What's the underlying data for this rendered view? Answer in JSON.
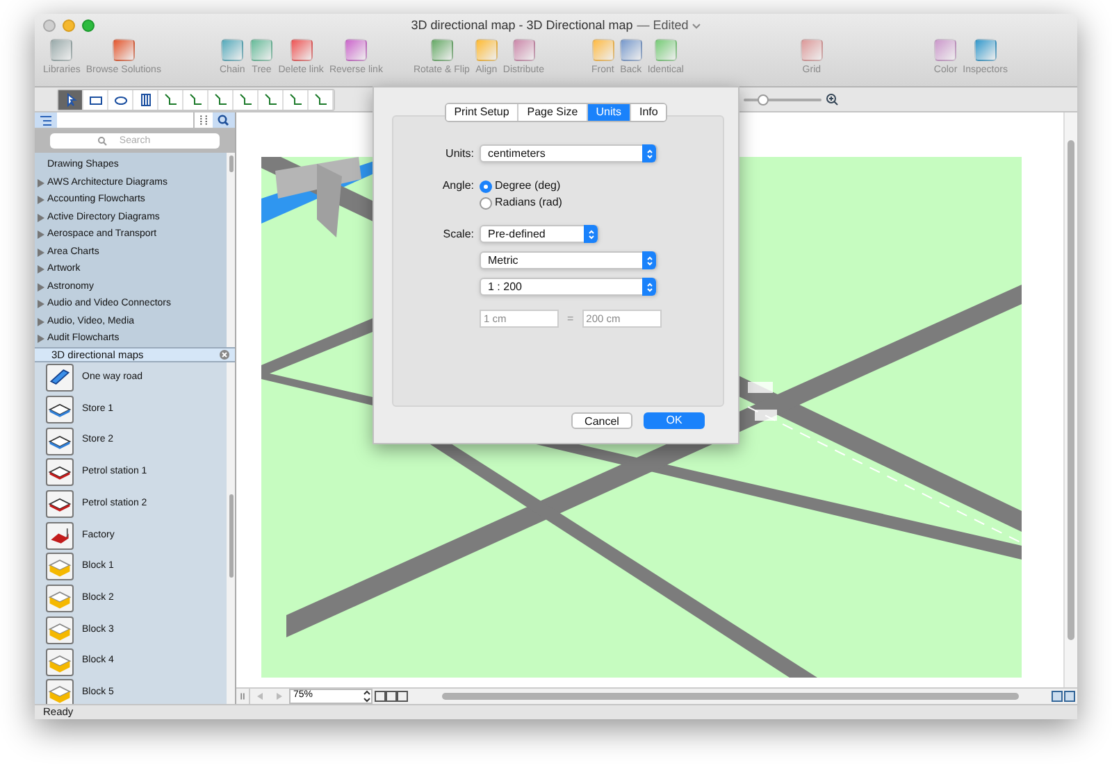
{
  "window": {
    "title": "3D directional map - 3D Directional map",
    "edited": "— Edited"
  },
  "toolbar": {
    "groups": [
      [
        {
          "label": "Libraries"
        },
        {
          "label": "Browse Solutions"
        }
      ],
      [
        {
          "label": "Chain"
        },
        {
          "label": "Tree"
        },
        {
          "label": "Delete link"
        },
        {
          "label": "Reverse link"
        }
      ],
      [
        {
          "label": "Rotate & Flip"
        },
        {
          "label": "Align"
        },
        {
          "label": "Distribute"
        }
      ],
      [
        {
          "label": "Front"
        },
        {
          "label": "Back"
        },
        {
          "label": "Identical"
        }
      ],
      [
        {
          "label": "Grid"
        }
      ],
      [
        {
          "label": "Color"
        },
        {
          "label": "Inspectors"
        }
      ]
    ]
  },
  "zoom_slider": {
    "level": 0.2
  },
  "sidebar": {
    "search": {
      "placeholder": "Search"
    },
    "libraries": [
      {
        "label": "Drawing Shapes",
        "kind": "plain"
      },
      {
        "label": "AWS Architecture Diagrams",
        "kind": "group"
      },
      {
        "label": "Accounting Flowcharts",
        "kind": "group"
      },
      {
        "label": "Active Directory Diagrams",
        "kind": "group"
      },
      {
        "label": "Aerospace and Transport",
        "kind": "group"
      },
      {
        "label": "Area Charts",
        "kind": "group"
      },
      {
        "label": "Artwork",
        "kind": "group"
      },
      {
        "label": "Astronomy",
        "kind": "group"
      },
      {
        "label": "Audio and Video Connectors",
        "kind": "group"
      },
      {
        "label": "Audio, Video, Media",
        "kind": "group"
      },
      {
        "label": "Audit Flowcharts",
        "kind": "group"
      }
    ],
    "open_library": {
      "title": "3D directional maps",
      "shapes": [
        {
          "label": "One way road",
          "kind": "road"
        },
        {
          "label": "Store 1",
          "kind": "store"
        },
        {
          "label": "Store 2",
          "kind": "store"
        },
        {
          "label": "Petrol station 1",
          "kind": "petrol"
        },
        {
          "label": "Petrol station 2",
          "kind": "petrol"
        },
        {
          "label": "Factory",
          "kind": "factory"
        },
        {
          "label": "Block 1",
          "kind": "block"
        },
        {
          "label": "Block 2",
          "kind": "block"
        },
        {
          "label": "Block 3",
          "kind": "block"
        },
        {
          "label": "Block 4",
          "kind": "block"
        },
        {
          "label": "Block 5",
          "kind": "block"
        }
      ]
    }
  },
  "dialog": {
    "tabs": [
      {
        "label": "Print Setup",
        "selected": false
      },
      {
        "label": "Page Size",
        "selected": false
      },
      {
        "label": "Units",
        "selected": true
      },
      {
        "label": "Info",
        "selected": false
      }
    ],
    "units": {
      "label": "Units:",
      "value": "centimeters"
    },
    "angle": {
      "label": "Angle:",
      "options": [
        {
          "label": "Degree (deg)",
          "selected": true
        },
        {
          "label": "Radians (rad)",
          "selected": false
        }
      ]
    },
    "scale": {
      "label": "Scale:",
      "mode": "Pre-defined",
      "system": "Metric",
      "ratio": "1 : 200",
      "from": "1 cm",
      "equals": "=",
      "to": "200 cm"
    },
    "buttons": [
      {
        "label": "Cancel",
        "kind": "normal"
      },
      {
        "label": "OK",
        "kind": "default"
      }
    ]
  },
  "bottom_bar": {
    "zoom": "75%"
  },
  "status_bar": "Ready"
}
